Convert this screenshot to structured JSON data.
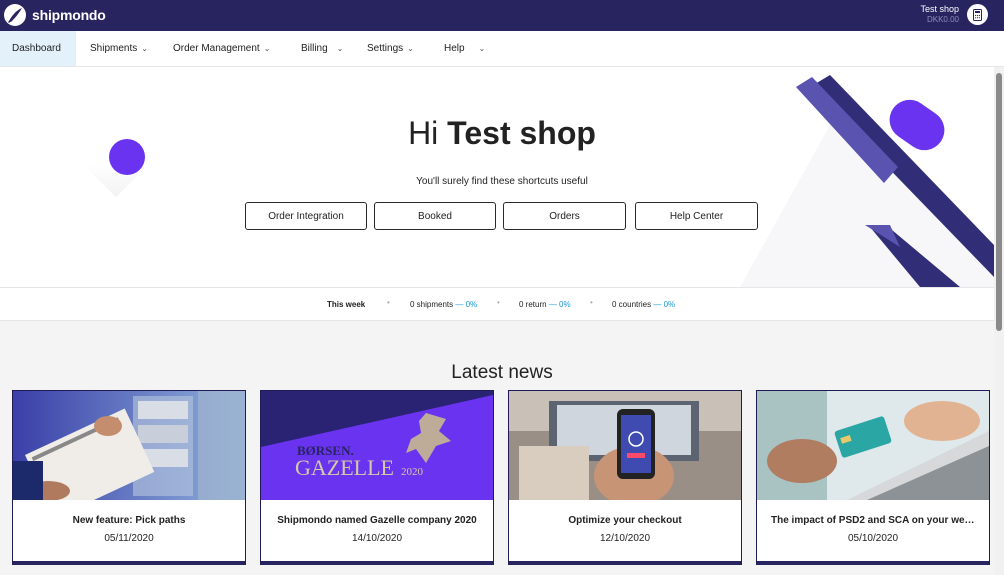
{
  "app": {
    "logo_text": "shipmondo",
    "account_name": "Test shop",
    "account_balance": "DKK0.00"
  },
  "nav": {
    "items": [
      {
        "label": "Dashboard"
      },
      {
        "label": "Shipments"
      },
      {
        "label": "Order Management"
      },
      {
        "label": "Billing"
      },
      {
        "label": "Settings"
      },
      {
        "label": "Help"
      }
    ],
    "chevron": "⌄"
  },
  "hero": {
    "greeting": "Hi",
    "shop_name": "Test shop",
    "subtitle": "You'll surely find these shortcuts useful",
    "shortcuts": [
      {
        "label": "Order Integration"
      },
      {
        "label": "Booked"
      },
      {
        "label": "Orders"
      },
      {
        "label": "Help Center"
      }
    ]
  },
  "stats": {
    "period": "This week",
    "items": [
      {
        "label": "0 shipments",
        "change": "0%"
      },
      {
        "label": "0 return",
        "change": "0%"
      },
      {
        "label": "0 countries",
        "change": "0%"
      }
    ]
  },
  "news": {
    "heading": "Latest news",
    "items": [
      {
        "title": "New feature: Pick paths",
        "date": "05/11/2020",
        "image": "warehouse-clipboard-photo"
      },
      {
        "title": "Shipmondo named Gazelle company 2020",
        "date": "14/10/2020",
        "image": "gazelle-award-banner",
        "banner_brand": "BØRSEN.",
        "banner_word": "GAZELLE",
        "banner_year": "2020"
      },
      {
        "title": "Optimize your checkout",
        "date": "12/10/2020",
        "image": "phone-checkout-photo"
      },
      {
        "title": "The impact of PSD2 and SCA on your web...",
        "date": "05/10/2020",
        "image": "credit-card-laptop-photo"
      }
    ]
  },
  "colors": {
    "brand_dark": "#272460",
    "accent_purple": "#6a33f0",
    "active_nav_bg": "#e3f1fb",
    "percent_blue": "#1a9ad6"
  }
}
